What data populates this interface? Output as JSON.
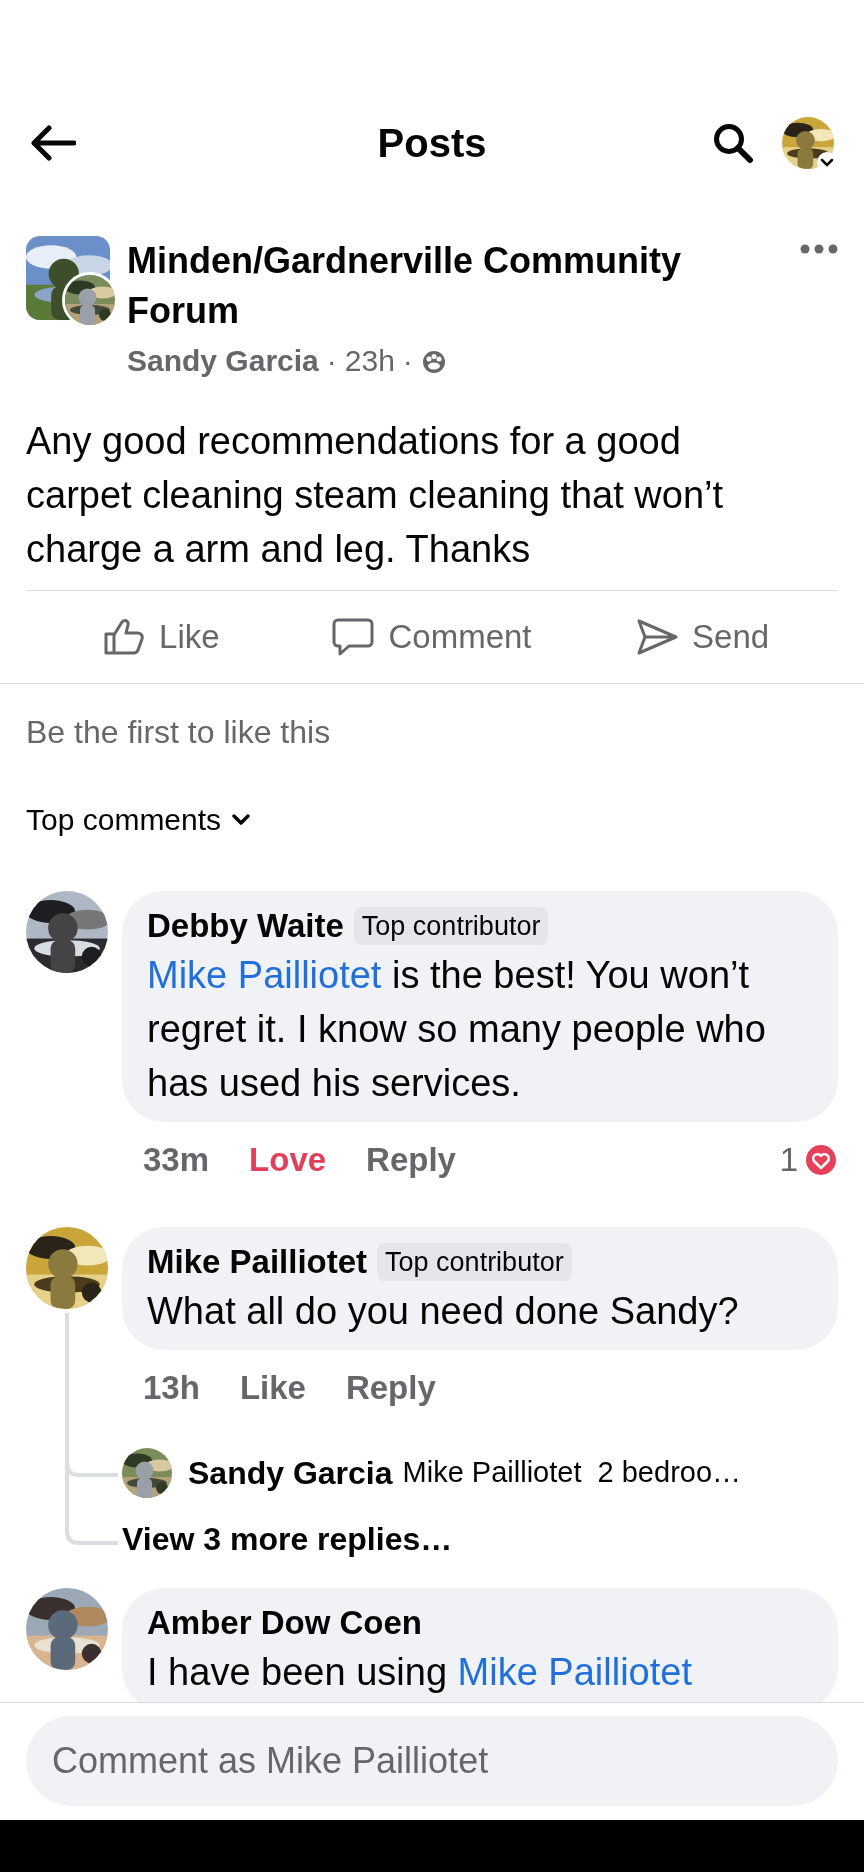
{
  "header": {
    "title": "Posts"
  },
  "post": {
    "group": "Minden/Gardnerville Community Forum",
    "author": "Sandy Garcia",
    "separators": [
      "·",
      "·"
    ],
    "time": "23h",
    "text": "Any good recommendations for a good carpet cleaning steam cleaning that won’t charge a arm and leg. Thanks",
    "actions": [
      {
        "label": "Like",
        "kind": "like"
      },
      {
        "label": "Comment",
        "kind": "comment"
      },
      {
        "label": "Send",
        "kind": "send"
      }
    ],
    "reactions_summary": "Be the first to like this"
  },
  "sort": {
    "label": "Top comments"
  },
  "comments": [
    {
      "author": "Debby Waite",
      "badge": "Top contributor",
      "segments": [
        {
          "kind": "mention",
          "text": "Mike Pailliotet"
        },
        {
          "kind": "plain",
          "text": " is the best! You won’t regret it. I know so many people who has used his services."
        }
      ],
      "time": "33m",
      "reaction": {
        "label": "Love",
        "kind": "love"
      },
      "reply_label": "Reply",
      "reaction_count": "1"
    },
    {
      "author": "Mike Pailliotet",
      "badge": "Top contributor",
      "segments": [
        {
          "kind": "plain",
          "text": "What all do you need done Sandy?"
        }
      ],
      "time": "13h",
      "reaction": {
        "label": "Like",
        "kind": "none"
      },
      "reply_label": "Reply",
      "reply_preview": {
        "author": "Sandy Garcia",
        "text": "Mike Pailliotet  2 bedroo…"
      },
      "more_replies": "View 3 more replies…"
    },
    {
      "author": "Amber Dow Coen",
      "segments": [
        {
          "kind": "plain",
          "text": "I have been using "
        },
        {
          "kind": "mention",
          "text": "Mike Pailliotet"
        }
      ]
    }
  ],
  "composer": {
    "placeholder": "Comment as Mike Pailliotet"
  }
}
